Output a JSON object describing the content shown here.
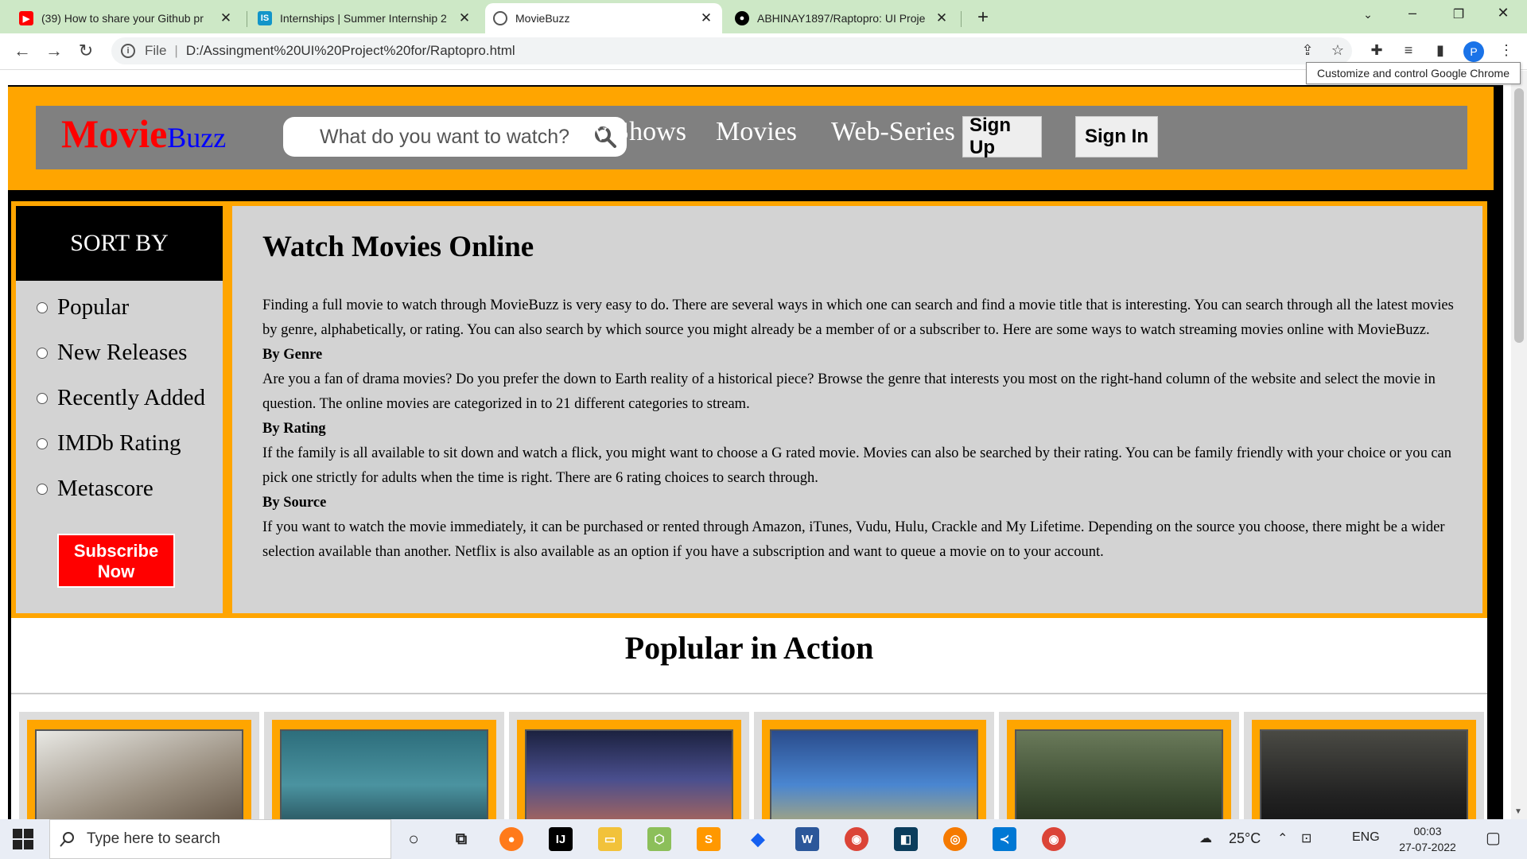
{
  "browser": {
    "tabs": [
      {
        "title": "(39) How to share your Github pr",
        "icon": "youtube-icon",
        "color": "#ff0000"
      },
      {
        "title": "Internships | Summer Internship 2",
        "icon": "internshala-icon",
        "color": "#1295c9"
      },
      {
        "title": "MovieBuzz",
        "icon": "globe-icon",
        "color": "#555555",
        "active": true
      },
      {
        "title": "ABHINAY1897/Raptopro: UI Proje",
        "icon": "github-icon",
        "color": "#000000"
      }
    ],
    "address": {
      "scheme_label": "File",
      "url": "D:/Assingment%20UI%20Project%20for/Raptopro.html"
    },
    "profile_initial": "P",
    "tooltip": "Customize and control Google Chrome"
  },
  "site": {
    "logo_movie": "Movie",
    "logo_buzz": "Buzz",
    "search_placeholder": "What do you want to watch?",
    "nav": {
      "tv_shows": "Tv Shows",
      "movies": "Movies",
      "web_series": "Web-Series",
      "sign_up": "Sign Up",
      "sign_in": "Sign In"
    },
    "sidebar": {
      "heading": "SORT BY",
      "options": [
        "Popular",
        "New Releases",
        "Recently Added",
        "IMDb Rating",
        "Metascore"
      ],
      "subscribe": "Subscribe Now"
    },
    "article": {
      "title": "Watch Movies Online",
      "intro": "Finding a full movie to watch through MovieBuzz is very easy to do. There are several ways in which one can search and find a movie title that is interesting. You can search through all the latest movies by genre, alphabetically, or rating. You can also search by which source you might already be a member of or a subscriber to. Here are some ways to watch streaming movies online with MovieBuzz.",
      "genre_heading": "By Genre",
      "genre_text": "Are you a fan of drama movies? Do you prefer the down to Earth reality of a historical piece? Browse the genre that interests you most on the right-hand column of the website and select the movie in question. The online movies are categorized in to 21 different categories to stream.",
      "rating_heading": "By Rating",
      "rating_text": "If the family is all available to sit down and watch a flick, you might want to choose a G rated movie. Movies can also be searched by their rating. You can be family friendly with your choice or you can pick one strictly for adults when the time is right. There are 6 rating choices to search through.",
      "source_heading": "By Source",
      "source_text": "If you want to watch the movie immediately, it can be purchased or rented through Amazon, iTunes, Vudu, Hulu, Crackle and My Lifetime. Depending on the source you choose, there might be a wider selection available than another. Netflix is also available as an option if you have a subscription and want to queue a movie on to your account."
    },
    "popular_title": "Poplular in Action",
    "posters": [
      "#b8b8b0",
      "#2f6b7a",
      "#3b3f6e",
      "#3b6fb0",
      "#4a5a40",
      "#2a2a2a"
    ]
  },
  "taskbar": {
    "search_placeholder": "Type here to search",
    "temperature": "25°C",
    "language": "ENG",
    "time": "00:03",
    "date": "27-07-2022"
  },
  "colors": {
    "accent_orange": "#ffa500",
    "nav_gray": "#808080",
    "panel_gray": "#d3d3d3",
    "logo_red": "#ff0000",
    "logo_blue": "#0000ff"
  }
}
